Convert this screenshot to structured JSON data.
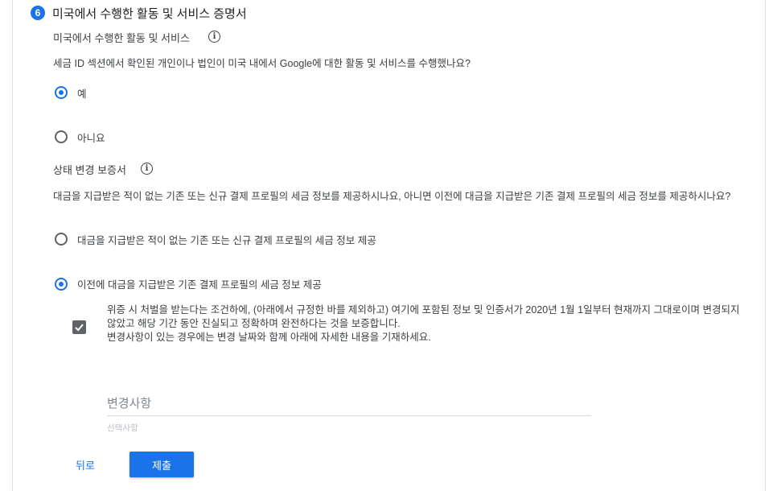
{
  "section": {
    "step_number": "6",
    "title": "미국에서 수행한 활동 및 서비스 증명서"
  },
  "activities": {
    "label": "미국에서 수행한 활동 및 서비스",
    "question": "세금 ID 섹션에서 확인된 개인이나 법인이 미국 내에서 Google에 대한 활동 및 서비스를 수행했나요?",
    "options": [
      {
        "label": "예",
        "checked": true
      },
      {
        "label": "아니요",
        "checked": false
      }
    ]
  },
  "status_change": {
    "label": "상태 변경 보증서",
    "question": "대금을 지급받은 적이 없는 기존 또는 신규 결제 프로필의 세금 정보를 제공하시나요, 아니면 이전에 대금을 지급받은 기존 결제 프로필의 세금 정보를 제공하시나요?",
    "options": [
      {
        "label": "대금을 지급받은 적이 없는 기존 또는 신규 결제 프로필의 세금 정보 제공",
        "checked": false
      },
      {
        "label": "이전에 대금을 지급받은 기존 결제 프로필의 세금 정보 제공",
        "checked": true
      }
    ]
  },
  "certification": {
    "checked": true,
    "text_line1": "위증 시 처벌을 받는다는 조건하에, (아래에서 규정한 바를 제외하고) 여기에 포함된 정보 및 인증서가 2020년 1월 1일부터 현재까지 그대로이며 변경되지 않았고 해당 기간 동안 진실되고 정확하며 완전하다는 것을 보증합니다.",
    "text_line2": "변경사항이 있는 경우에는 변경 날짜와 함께 아래에 자세한 내용을 기재하세요."
  },
  "changes": {
    "label": "변경사항",
    "hint": "선택사항",
    "value": ""
  },
  "buttons": {
    "back": "뒤로",
    "submit": "제출"
  },
  "colors": {
    "accent": "#1a73e8",
    "text": "#3c4043",
    "checkbox": "#5f6368"
  }
}
